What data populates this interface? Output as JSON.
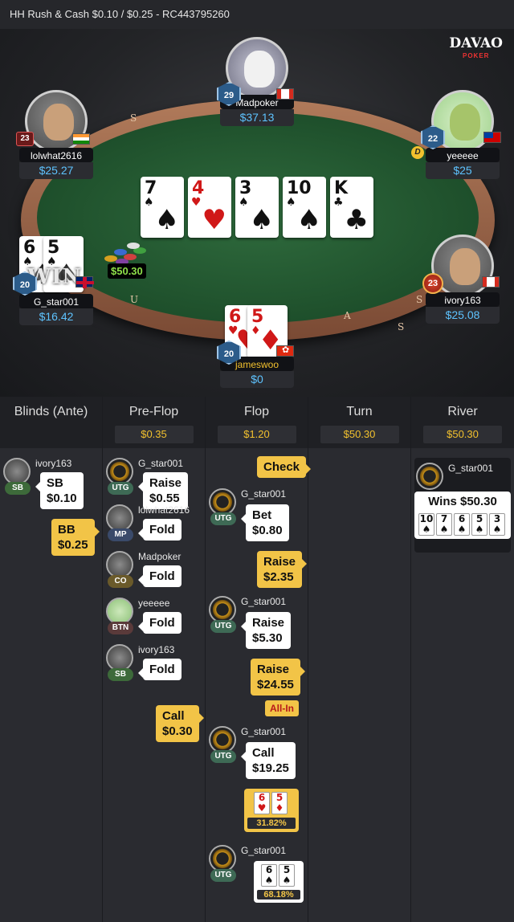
{
  "header": {
    "title": "HH  Rush & Cash $0.10 / $0.25   - RC443795260"
  },
  "logo": {
    "name": "DAVAO",
    "sub": "POKER"
  },
  "rail_letters": [
    "S",
    "S",
    "U",
    "S",
    "A"
  ],
  "seats": {
    "madpoker": {
      "name": "Madpoker",
      "stack": "$37.13",
      "level": "29"
    },
    "lolwhat": {
      "name": "lolwhat2616",
      "stack": "$25.27",
      "level": "23"
    },
    "yeeeee": {
      "name": "yeeeee",
      "stack": "$25",
      "level": "22",
      "dealer": "D"
    },
    "gstar": {
      "name": "G_star001",
      "stack": "$16.42",
      "level": "20"
    },
    "ivory": {
      "name": "ivory163",
      "stack": "$25.08",
      "level": "23"
    },
    "jameswoo": {
      "name": "jameswoo",
      "stack": "$0",
      "level": "20"
    }
  },
  "board": [
    {
      "rank": "7",
      "suit": "♠",
      "color": "#111111"
    },
    {
      "rank": "4",
      "suit": "♥",
      "color": "#d01818"
    },
    {
      "rank": "3",
      "suit": "♠",
      "color": "#111111"
    },
    {
      "rank": "10",
      "suit": "♠",
      "color": "#111111"
    },
    {
      "rank": "K",
      "suit": "♣",
      "color": "#111111"
    }
  ],
  "gstar_cards": [
    {
      "rank": "6",
      "suit": "♠"
    },
    {
      "rank": "5",
      "suit": "♠"
    }
  ],
  "jameswoo_cards": [
    {
      "rank": "6",
      "suit": "♥"
    },
    {
      "rank": "5",
      "suit": "♦"
    }
  ],
  "win_label": "WIN",
  "pot_amount": "$50.30",
  "history": {
    "columns": [
      {
        "title": "Blinds (Ante)",
        "pot": ""
      },
      {
        "title": "Pre-Flop",
        "pot": "$0.35"
      },
      {
        "title": "Flop",
        "pot": "$1.20"
      },
      {
        "title": "Turn",
        "pot": "$50.30"
      },
      {
        "title": "River",
        "pot": "$50.30"
      }
    ],
    "blinds": {
      "p1_name": "ivory163",
      "p1_pos": "SB",
      "p1_action": "SB",
      "p1_amount": "$0.10",
      "bb_action": "BB",
      "bb_amount": "$0.25"
    },
    "preflop": [
      {
        "name": "G_star001",
        "pos": "UTG",
        "action": "Raise",
        "amount": "$0.55"
      },
      {
        "name": "lolwhat2616",
        "pos": "MP",
        "action": "Fold",
        "amount": ""
      },
      {
        "name": "Madpoker",
        "pos": "CO",
        "action": "Fold",
        "amount": ""
      },
      {
        "name": "yeeeee",
        "pos": "BTN",
        "action": "Fold",
        "amount": ""
      },
      {
        "name": "ivory163",
        "pos": "SB",
        "action": "Fold",
        "amount": ""
      }
    ],
    "preflop_call": {
      "action": "Call",
      "amount": "$0.30"
    },
    "flop": {
      "check": "Check",
      "bet_name": "G_star001",
      "bet_pos": "UTG",
      "bet_action": "Bet",
      "bet_amount": "$0.80",
      "raise1_action": "Raise",
      "raise1_amount": "$2.35",
      "raise2_name": "G_star001",
      "raise2_pos": "UTG",
      "raise2_action": "Raise",
      "raise2_amount": "$5.30",
      "raise3_action": "Raise",
      "raise3_amount": "$24.55",
      "allin": "All-In",
      "call_name": "G_star001",
      "call_pos": "UTG",
      "call_action": "Call",
      "call_amount": "$19.25",
      "eq1_cards": [
        "6♥",
        "5♦"
      ],
      "eq1": "31.82%",
      "eq2_name": "G_star001",
      "eq2_pos": "UTG",
      "eq2_cards": [
        "6♠",
        "5♠"
      ],
      "eq2": "68.18%"
    },
    "river": {
      "name": "G_star001",
      "result": "Wins $50.30",
      "cards": [
        "10♠",
        "7♠",
        "6♠",
        "5♠",
        "3♠"
      ]
    }
  }
}
